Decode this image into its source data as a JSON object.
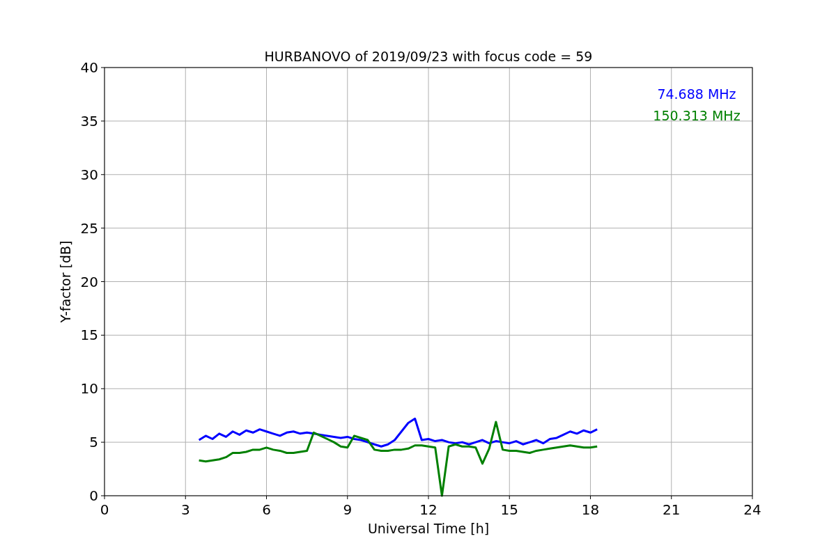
{
  "chart_data": {
    "type": "line",
    "title": "HURBANOVO of 2019/09/23 with focus code = 59",
    "xlabel": "Universal Time [h]",
    "ylabel": "Y-factor [dB]",
    "x": [
      3.5,
      3.75,
      4,
      4.25,
      4.5,
      4.75,
      5,
      5.25,
      5.5,
      5.75,
      6,
      6.25,
      6.5,
      6.75,
      7,
      7.25,
      7.5,
      7.75,
      8,
      8.25,
      8.5,
      8.75,
      9,
      9.25,
      9.5,
      9.75,
      10,
      10.25,
      10.5,
      10.75,
      11,
      11.25,
      11.5,
      11.75,
      12,
      12.25,
      12.5,
      12.75,
      13,
      13.25,
      13.5,
      13.75,
      14,
      14.25,
      14.5,
      14.75,
      15,
      15.25,
      15.5,
      15.75,
      16,
      16.25,
      16.5,
      16.75,
      17,
      17.25,
      17.5,
      17.75,
      18,
      18.25
    ],
    "series": [
      {
        "name": "74.688 MHz",
        "color": "#0000ff",
        "values": [
          5.2,
          5.6,
          5.3,
          5.8,
          5.5,
          6.0,
          5.7,
          6.1,
          5.9,
          6.2,
          6.0,
          5.8,
          5.6,
          5.9,
          6.0,
          5.8,
          5.9,
          5.8,
          5.7,
          5.6,
          5.5,
          5.4,
          5.5,
          5.3,
          5.2,
          5.0,
          4.8,
          4.6,
          4.8,
          5.2,
          6.0,
          6.8,
          7.2,
          5.2,
          5.3,
          5.1,
          5.2,
          5.0,
          4.9,
          5.0,
          4.8,
          5.0,
          5.2,
          4.9,
          5.1,
          5.0,
          4.9,
          5.1,
          4.8,
          5.0,
          5.2,
          4.9,
          5.3,
          5.4,
          5.7,
          6.0,
          5.8,
          6.1,
          5.9,
          6.2
        ]
      },
      {
        "name": "150.313 MHz",
        "color": "#008000",
        "values": [
          3.3,
          3.2,
          3.3,
          3.4,
          3.6,
          4.0,
          4.0,
          4.1,
          4.3,
          4.3,
          4.5,
          4.3,
          4.2,
          4.0,
          4.0,
          4.1,
          4.2,
          5.9,
          5.6,
          5.3,
          5.0,
          4.6,
          4.5,
          5.6,
          5.4,
          5.2,
          4.3,
          4.2,
          4.2,
          4.3,
          4.3,
          4.4,
          4.7,
          4.7,
          4.6,
          4.5,
          0,
          4.6,
          4.8,
          4.6,
          4.6,
          4.5,
          3.0,
          4.4,
          6.9,
          4.3,
          4.2,
          4.2,
          4.1,
          4.0,
          4.2,
          4.3,
          4.4,
          4.5,
          4.6,
          4.7,
          4.6,
          4.5,
          4.5,
          4.6
        ]
      }
    ],
    "xlim": [
      0,
      24
    ],
    "ylim": [
      0,
      40
    ],
    "xticks": [
      0,
      3,
      6,
      9,
      12,
      15,
      18,
      21,
      24
    ],
    "yticks": [
      0,
      5,
      10,
      15,
      20,
      25,
      30,
      35,
      40
    ],
    "grid": true
  }
}
